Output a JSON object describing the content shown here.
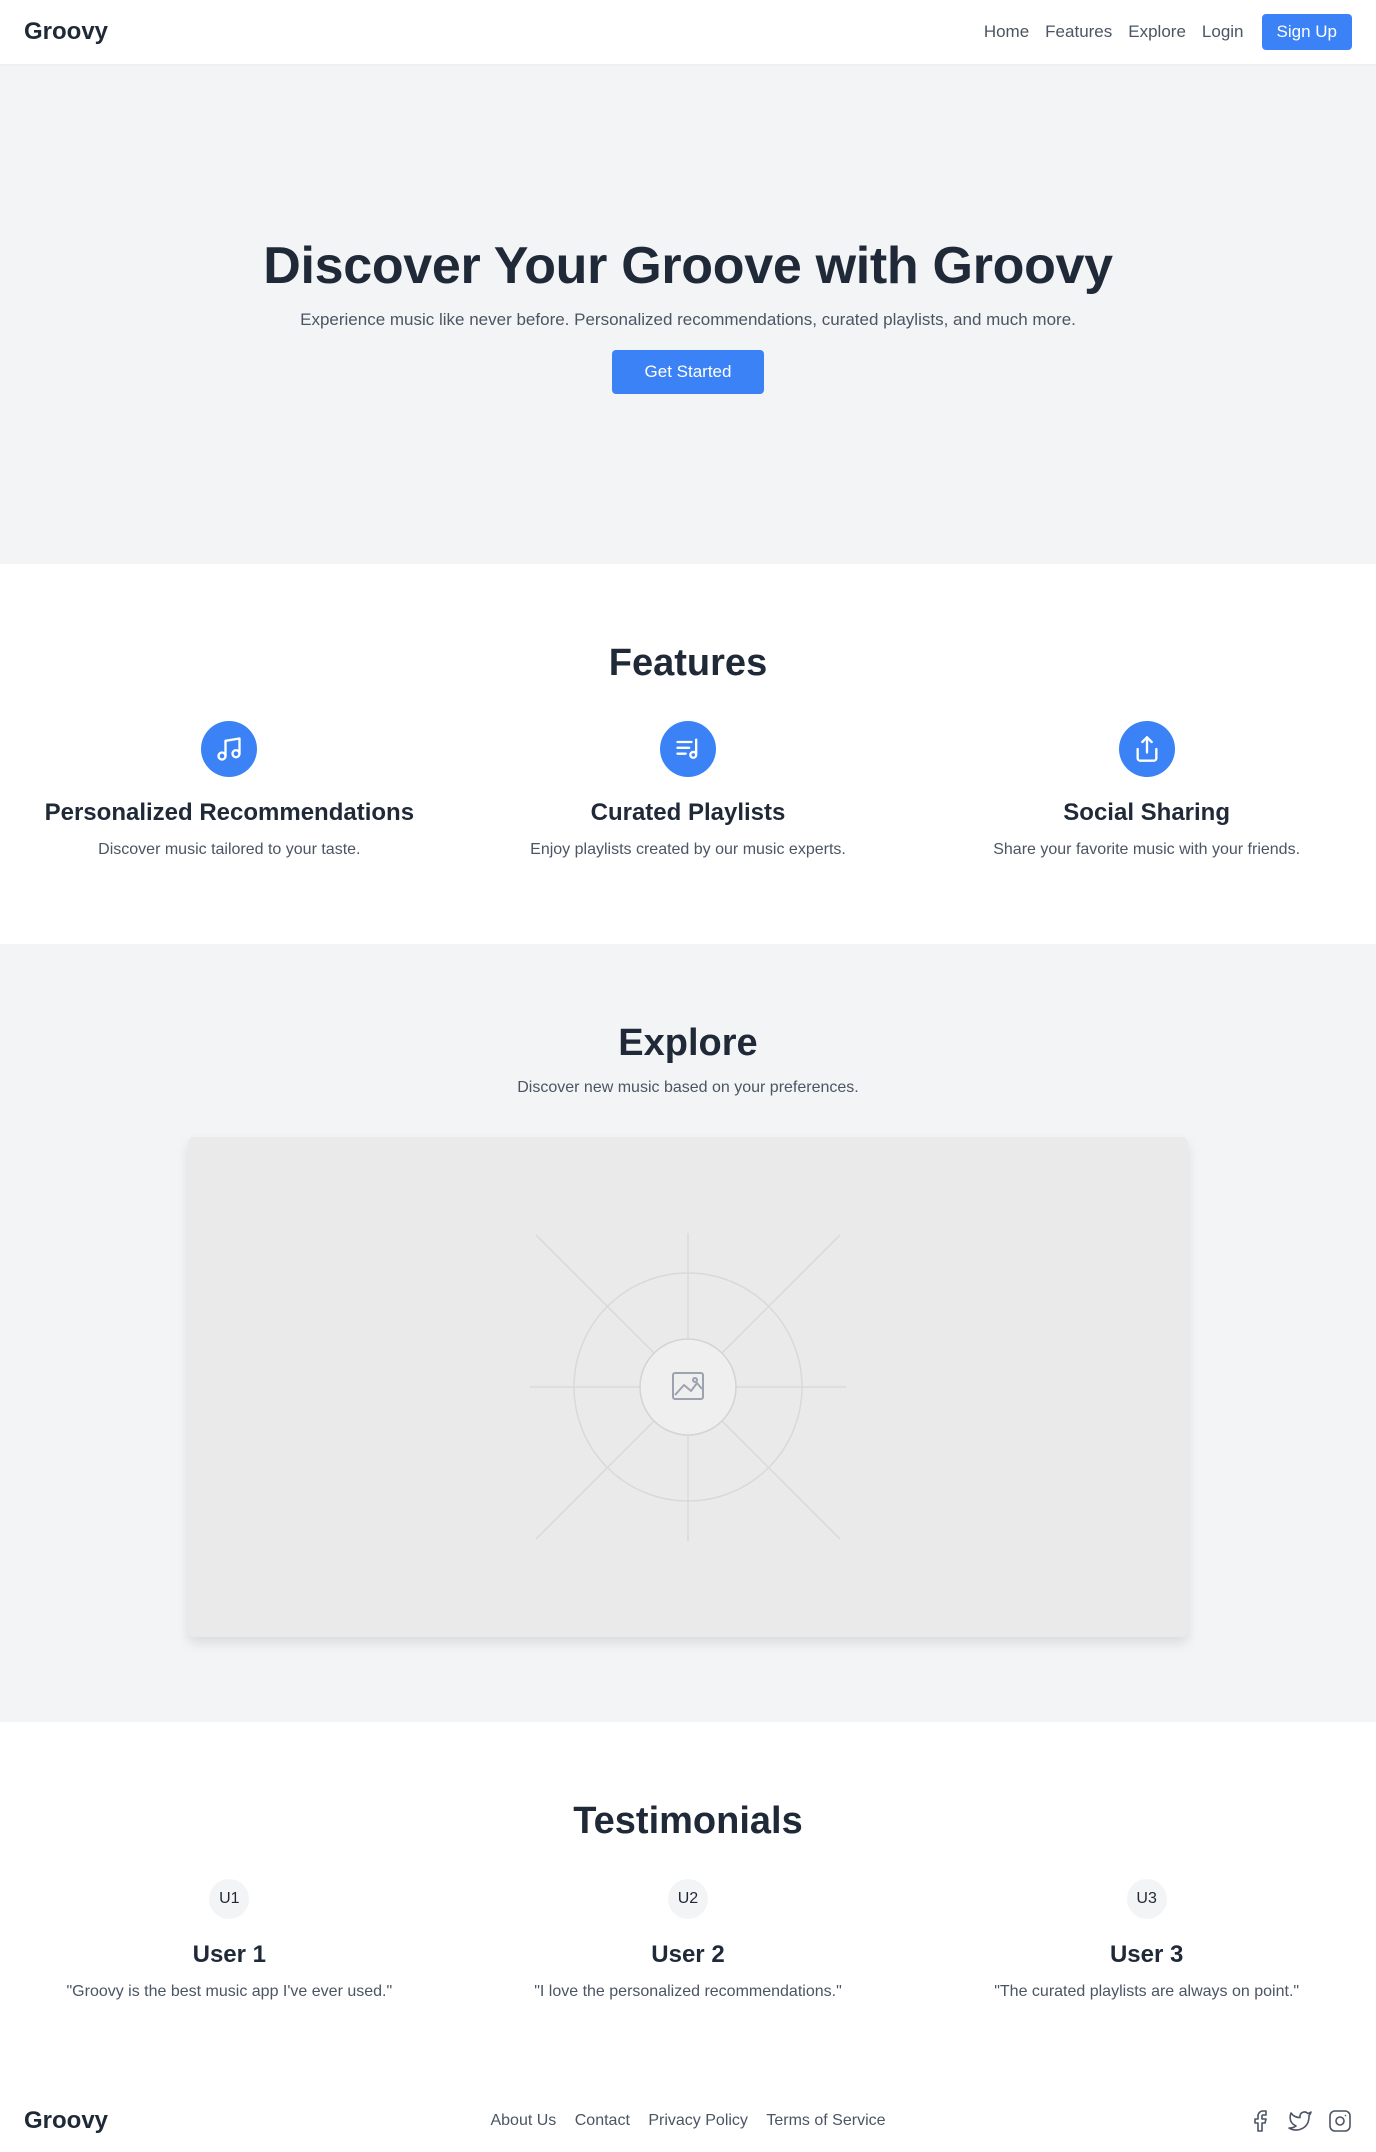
{
  "nav": {
    "brand": "Groovy",
    "links": [
      "Home",
      "Features",
      "Explore",
      "Login"
    ],
    "signup": "Sign Up"
  },
  "hero": {
    "title": "Discover Your Groove with Groovy",
    "subtitle": "Experience music like never before. Personalized recommendations, curated playlists, and much more.",
    "cta": "Get Started"
  },
  "features": {
    "title": "Features",
    "items": [
      {
        "icon": "music-note-icon",
        "title": "Personalized Recommendations",
        "desc": "Discover music tailored to your taste."
      },
      {
        "icon": "playlist-icon",
        "title": "Curated Playlists",
        "desc": "Enjoy playlists created by our music experts."
      },
      {
        "icon": "share-icon",
        "title": "Social Sharing",
        "desc": "Share your favorite music with your friends."
      }
    ]
  },
  "explore": {
    "title": "Explore",
    "subtitle": "Discover new music based on your preferences.",
    "media_icon": "image-placeholder-icon"
  },
  "testimonials": {
    "title": "Testimonials",
    "items": [
      {
        "avatar": "U1",
        "name": "User 1",
        "quote": "\"Groovy is the best music app I've ever used.\""
      },
      {
        "avatar": "U2",
        "name": "User 2",
        "quote": "\"I love the personalized recommendations.\""
      },
      {
        "avatar": "U3",
        "name": "User 3",
        "quote": "\"The curated playlists are always on point.\""
      }
    ]
  },
  "footer": {
    "brand": "Groovy",
    "links": [
      "About Us",
      "Contact",
      "Privacy Policy",
      "Terms of Service"
    ],
    "social": [
      "facebook-icon",
      "twitter-icon",
      "instagram-icon"
    ]
  },
  "colors": {
    "accent": "#3b82f6",
    "text_dark": "#1f2937",
    "text_muted": "#4b5563",
    "section_bg": "#f3f4f6"
  }
}
